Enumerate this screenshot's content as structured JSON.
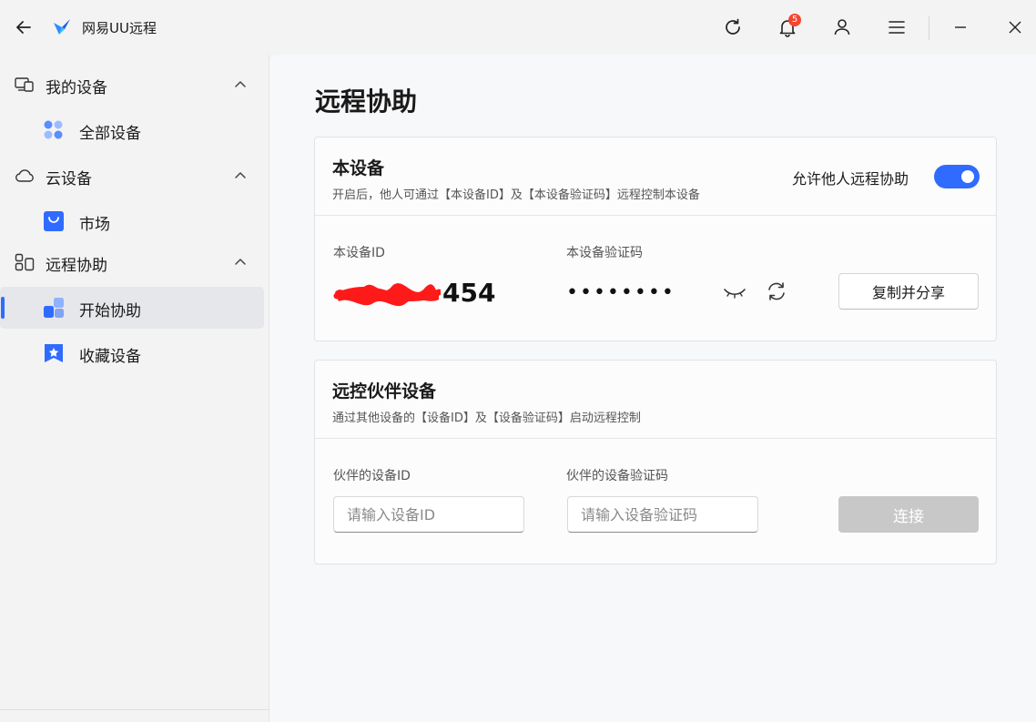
{
  "app": {
    "title": "网易UU远程",
    "notification_count": "5"
  },
  "sidebar": {
    "groups": [
      {
        "label": "我的设备",
        "icon": "devices-icon",
        "items": [
          {
            "label": "全部设备",
            "icon": "grid-dots-icon"
          }
        ]
      },
      {
        "label": "云设备",
        "icon": "cloud-icon",
        "items": [
          {
            "label": "市场",
            "icon": "shopping-bag-icon"
          }
        ]
      },
      {
        "label": "远程协助",
        "icon": "remote-assist-icon",
        "items": [
          {
            "label": "开始协助",
            "icon": "start-assist-icon",
            "active": true
          },
          {
            "label": "收藏设备",
            "icon": "bookmark-star-icon"
          }
        ]
      }
    ]
  },
  "main": {
    "page_title": "远程协助",
    "this_device": {
      "title": "本设备",
      "subtitle": "开启后，他人可通过【本设备ID】及【本设备验证码】远程控制本设备",
      "toggle_label": "允许他人远程协助",
      "toggle_on": true,
      "id_label": "本设备ID",
      "id_visible_tail": "454",
      "code_label": "本设备验证码",
      "code_masked": "••••••••",
      "copy_button": "复制并分享"
    },
    "partner_device": {
      "title": "远控伙伴设备",
      "subtitle": "通过其他设备的【设备ID】及【设备验证码】启动远程控制",
      "id_label": "伙伴的设备ID",
      "id_placeholder": "请输入设备ID",
      "code_label": "伙伴的设备验证码",
      "code_placeholder": "请输入设备验证码",
      "connect_button": "连接"
    }
  },
  "colors": {
    "accent": "#2f6bff",
    "badge": "#f5452f",
    "redaction": "#ff1a1a"
  }
}
